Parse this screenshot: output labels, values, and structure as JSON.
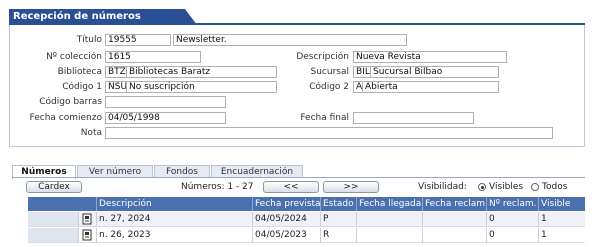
{
  "header": {
    "title": "Recepción de números"
  },
  "form": {
    "titulo": {
      "label": "Título",
      "code": "19555",
      "value": "Newsletter."
    },
    "no_coleccion": {
      "label": "Nº colección",
      "value": "1615"
    },
    "descripcion": {
      "label": "Descripción",
      "value": "Nueva Revista"
    },
    "biblioteca": {
      "label": "Biblioteca",
      "code": "BTZ",
      "value": "Bibliotecas Baratz"
    },
    "sucursal": {
      "label": "Sucursal",
      "code": "BIL",
      "value": "Sucursal Bilbao"
    },
    "codigo1": {
      "label": "Código 1",
      "code": "NSU",
      "value": "No suscripción"
    },
    "codigo2": {
      "label": "Código 2",
      "code": "A",
      "value": "Abierta"
    },
    "codigo_barras": {
      "label": "Código barras",
      "value": ""
    },
    "fecha_comienzo": {
      "label": "Fecha comienzo",
      "value": "04/05/1998"
    },
    "fecha_final": {
      "label": "Fecha final",
      "value": ""
    },
    "nota": {
      "label": "Nota",
      "value": ""
    }
  },
  "tabs": [
    "Números",
    "Ver número",
    "Fondos",
    "Encuadernación"
  ],
  "toolbar": {
    "cardex": "Cardex",
    "numeros_info": "Números: 1 - 27",
    "prev": "<<",
    "next": ">>",
    "visibilidad_label": "Visibilidad:",
    "opt_visibles": "Visibles",
    "opt_todos": "Todos",
    "selected": "Visibles"
  },
  "table": {
    "columns": [
      "Descripción",
      "Fecha prevista",
      "Estado",
      "Fecha llegada",
      "Fecha reclam.",
      "Nº reclam.",
      "Visible"
    ],
    "rows": [
      [
        "n. 27, 2024",
        "04/05/2024",
        "P",
        "",
        "",
        "0",
        "1"
      ],
      [
        "n. 26, 2023",
        "04/05/2023",
        "R",
        "",
        "",
        "0",
        "1"
      ]
    ]
  },
  "icons": {
    "row_icon": "document-icon"
  },
  "colors": {
    "header_bg": "#2a4f95",
    "table_header_bg": "#4a70b0"
  }
}
